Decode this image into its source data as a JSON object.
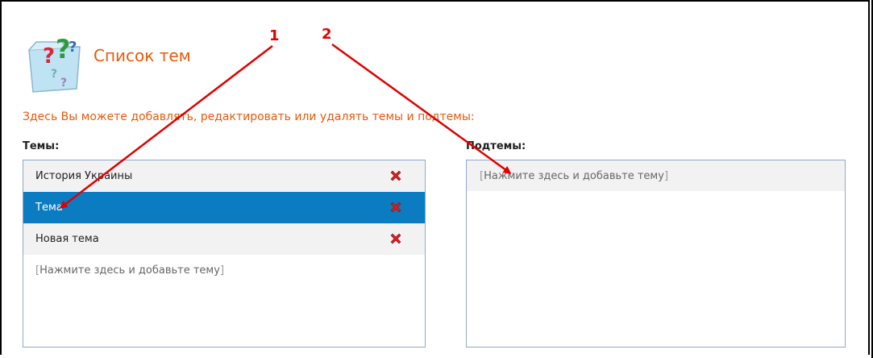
{
  "page": {
    "title": "Список тем",
    "description": "Здесь Вы можете добавлять, редактировать или удалять темы и подтемы:"
  },
  "topics": {
    "label": "Темы:",
    "items": [
      {
        "label": "История Украины",
        "selected": false
      },
      {
        "label": "Тема",
        "selected": true
      },
      {
        "label": "Новая тема",
        "selected": false
      }
    ],
    "add_placeholder": "Нажмите здесь и добавьте тему"
  },
  "subtopics": {
    "label": "Подтемы:",
    "add_placeholder": "Нажмите здесь и добавьте тему"
  },
  "annotations": {
    "one": "1",
    "two": "2"
  },
  "colors": {
    "accent_orange": "#e85a0c",
    "selected_blue": "#0b7cc1",
    "delete_red": "#d42020",
    "annotation_red": "#e00000"
  },
  "icons": {
    "header": "question-folder-icon",
    "delete": "delete-x-icon"
  }
}
